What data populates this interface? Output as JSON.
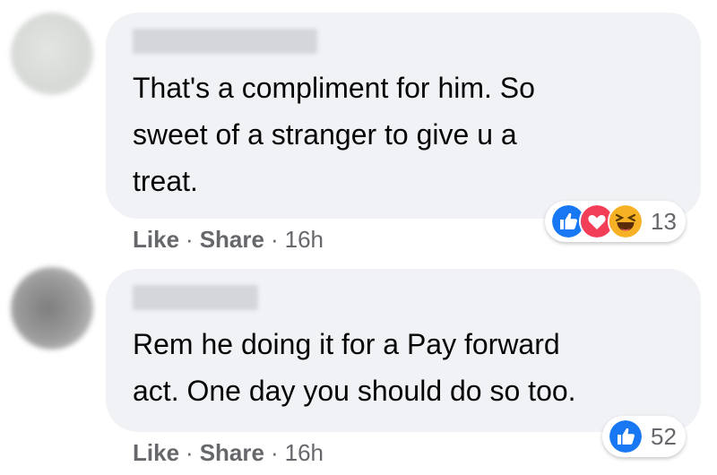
{
  "comments": [
    {
      "text": "That's a compliment for him. So\nsweet of a stranger to give u a\ntreat.",
      "actions": {
        "like": "Like",
        "share": "Share",
        "time": "16h"
      },
      "reactions": {
        "icons": [
          "like-icon",
          "love-icon",
          "haha-icon"
        ],
        "count": "13"
      }
    },
    {
      "text": "Rem he doing it for a Pay forward\nact. One day you should do so too.",
      "actions": {
        "like": "Like",
        "share": "Share",
        "time": "16h"
      },
      "reactions": {
        "icons": [
          "like-icon"
        ],
        "count": "52"
      }
    }
  ],
  "separator": "·",
  "colors": {
    "bubble": "#f0f2f5",
    "meta_text": "#65676b",
    "like_blue": "#1877f2",
    "love_red": "#f33e58",
    "haha_yellow": "#f7b125"
  }
}
